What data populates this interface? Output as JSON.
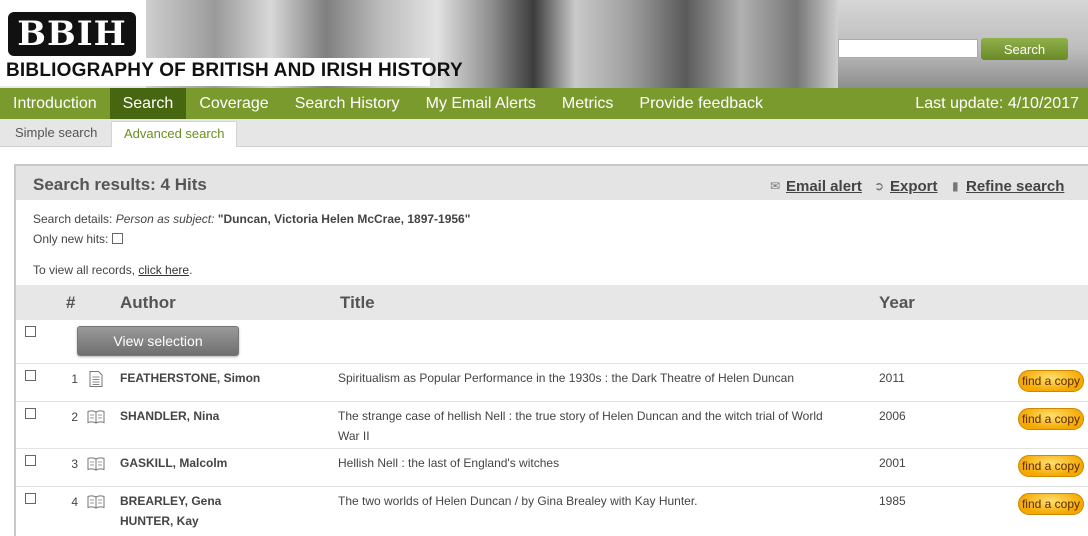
{
  "header": {
    "logo_text": "BBIH",
    "site_title": "BIBLIOGRAPHY OF BRITISH AND IRISH HISTORY",
    "search_button": "Search",
    "search_value": ""
  },
  "nav": {
    "items": [
      "Introduction",
      "Search",
      "Coverage",
      "Search History",
      "My Email Alerts",
      "Metrics",
      "Provide feedback"
    ],
    "active": "Search",
    "last_update": "Last update: 4/10/2017"
  },
  "subnav": {
    "simple": "Simple search",
    "advanced": "Advanced search",
    "active": "Advanced search"
  },
  "results": {
    "title": "Search results: 4 Hits",
    "actions": {
      "email_alert": "Email alert",
      "export": "Export",
      "refine": "Refine search"
    },
    "details_label": "Search details:",
    "details_field": "Person as subject",
    "details_value": "\"Duncan, Victoria Helen McCrae, 1897-1956\"",
    "only_new_label": "Only new hits:",
    "view_all_prefix": "To view all records,",
    "view_all_link": "click here",
    "view_all_suffix": ".",
    "columns": {
      "num": "#",
      "author": "Author",
      "title": "Title",
      "year": "Year"
    },
    "view_selection": "View selection",
    "find_label": "find a copy",
    "rows": [
      {
        "n": "1",
        "icon": "document-icon",
        "authors": [
          "FEATHERSTONE, Simon"
        ],
        "title_lines": [
          "Spiritualism as Popular Performance in the 1930s : the Dark Theatre of Helen Duncan"
        ],
        "year": "2011"
      },
      {
        "n": "2",
        "icon": "book-icon",
        "authors": [
          "SHANDLER, Nina"
        ],
        "title_lines": [
          "The strange case of hellish Nell : the true story of Helen Duncan and the witch trial of World",
          "War II"
        ],
        "year": "2006"
      },
      {
        "n": "3",
        "icon": "book-icon",
        "authors": [
          "GASKILL, Malcolm"
        ],
        "title_lines": [
          "Hellish Nell : the last of England's witches"
        ],
        "year": "2001"
      },
      {
        "n": "4",
        "icon": "book-icon",
        "authors": [
          "BREARLEY, Gena",
          "HUNTER, Kay"
        ],
        "title_lines": [
          "The two worlds of Helen Duncan / by Gina Brealey with Kay Hunter."
        ],
        "year": "1985"
      }
    ]
  }
}
